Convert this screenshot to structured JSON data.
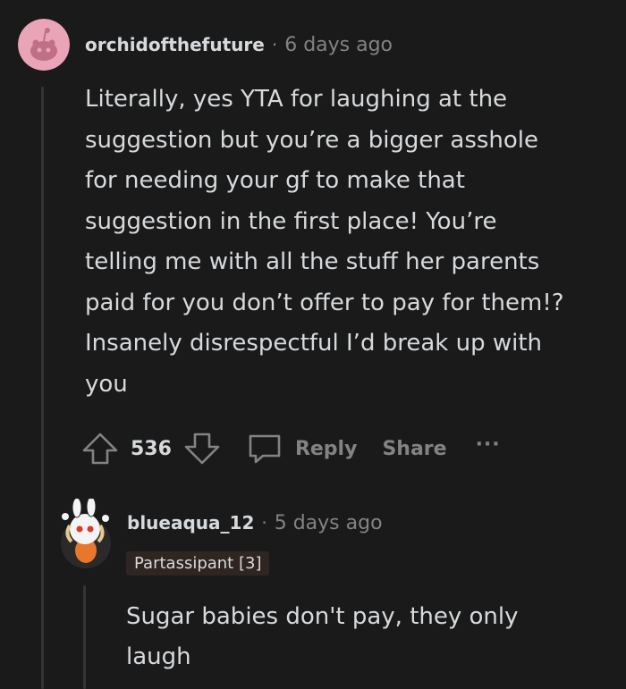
{
  "comment": {
    "username": "orchidofthefuture",
    "separator": "·",
    "time": "6 days ago",
    "avatar_color": "#e9a4b7",
    "lines": [
      "Literally, yes YTA for laughing at the",
      "suggestion but you’re a bigger asshole",
      "for needing your gf to make that",
      "suggestion in the first place! You’re",
      "telling me with all the stuff her parents",
      "paid for you don’t offer to pay for them!?",
      "Insanely disrespectful I’d break up with",
      "you"
    ],
    "actions": {
      "upvote_icon": "upvote-arrow-icon",
      "score": "536",
      "downvote_icon": "downvote-arrow-icon",
      "reply_icon": "speech-bubble-icon",
      "reply_label": "Reply",
      "share_label": "Share",
      "more_label": "···"
    }
  },
  "reply": {
    "username": "blueaqua_12",
    "separator": "·",
    "time": "5 days ago",
    "flair": "Partassipant [3]",
    "lines": [
      "Sugar babies don't pay, they only",
      "laugh"
    ]
  },
  "colors": {
    "background": "#1a1a1b",
    "text": "#d7dadc",
    "muted": "#818384",
    "thread_line": "#343536",
    "flair_bg": "#2f2521"
  }
}
